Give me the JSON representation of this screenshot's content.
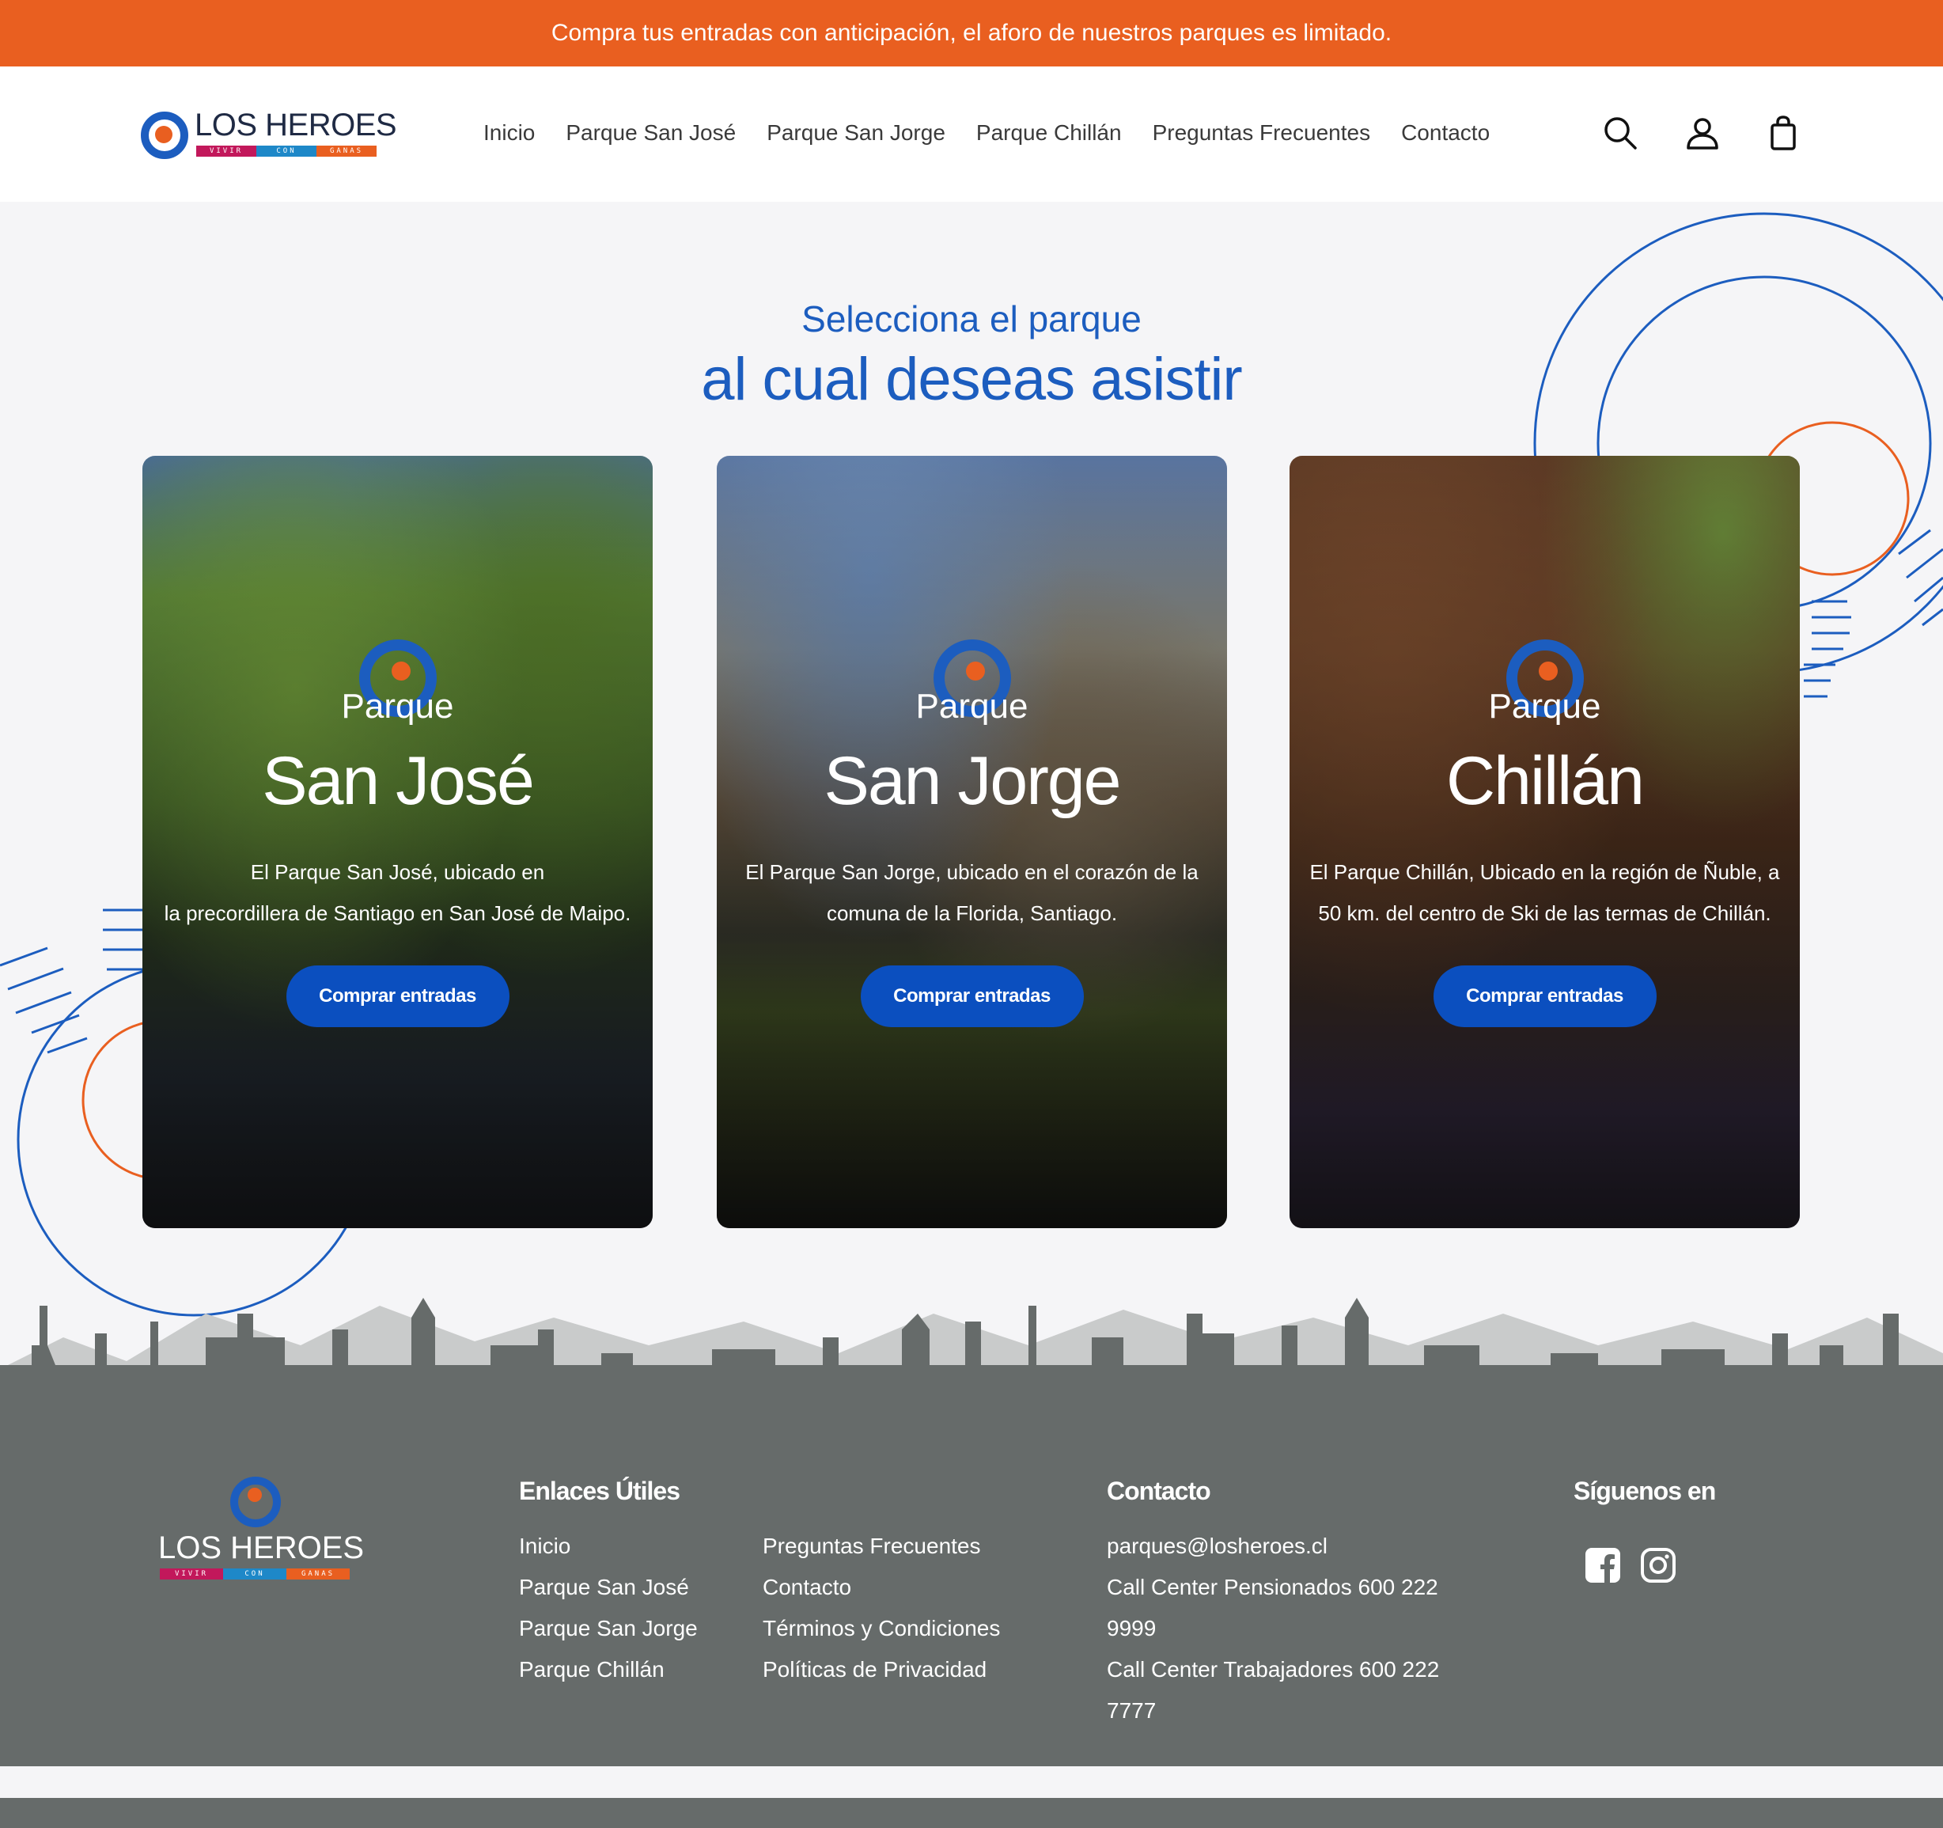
{
  "announcement": "Compra tus entradas con anticipación, el aforo de nuestros parques es limitado.",
  "brand": {
    "name": "LOS HEROES",
    "tagline": [
      "VIVIR",
      "CON",
      "GANAS"
    ],
    "colors": {
      "blue": "#1c5dbf",
      "orange": "#e95f20",
      "magenta": "#c2185b",
      "cyan": "#1e88c8",
      "footer": "#666b6a"
    }
  },
  "nav": [
    "Inicio",
    "Parque San José",
    "Parque San Jorge",
    "Parque Chillán",
    "Preguntas Frecuentes",
    "Contacto"
  ],
  "header_icons": [
    "search-icon",
    "user-icon",
    "bag-icon"
  ],
  "hero": {
    "subtitle": "Selecciona el parque",
    "title": "al cual deseas asistir"
  },
  "parks": [
    {
      "pre": "Parque",
      "name": "San José",
      "desc1": "El Parque San José, ubicado en",
      "desc2": "la precordillera de Santiago en San José de Maipo.",
      "button": "Comprar entradas"
    },
    {
      "pre": "Parque",
      "name": "San Jorge",
      "desc1": "El Parque San Jorge, ubicado en el corazón de la",
      "desc2": "comuna de la Florida, Santiago.",
      "button": "Comprar entradas"
    },
    {
      "pre": "Parque",
      "name": "Chillán",
      "desc1": "El Parque Chillán, Ubicado en la región de Ñuble, a",
      "desc2": "50 km. del centro de Ski de las termas de Chillán.",
      "button": "Comprar entradas"
    }
  ],
  "footer": {
    "links_heading": "Enlaces Útiles",
    "links_col1": [
      "Inicio",
      "Parque San José",
      "Parque San Jorge",
      "Parque Chillán"
    ],
    "links_col2": [
      "Preguntas Frecuentes",
      "Contacto",
      "Términos y Condiciones",
      "Políticas de Privacidad"
    ],
    "contact_heading": "Contacto",
    "contact": [
      "parques@losheroes.cl",
      "Call Center Pensionados 600 222",
      "9999",
      "Call Center Trabajadores 600 222",
      "7777"
    ],
    "social_heading": "Síguenos en",
    "social_icons": [
      "facebook-icon",
      "instagram-icon"
    ]
  }
}
